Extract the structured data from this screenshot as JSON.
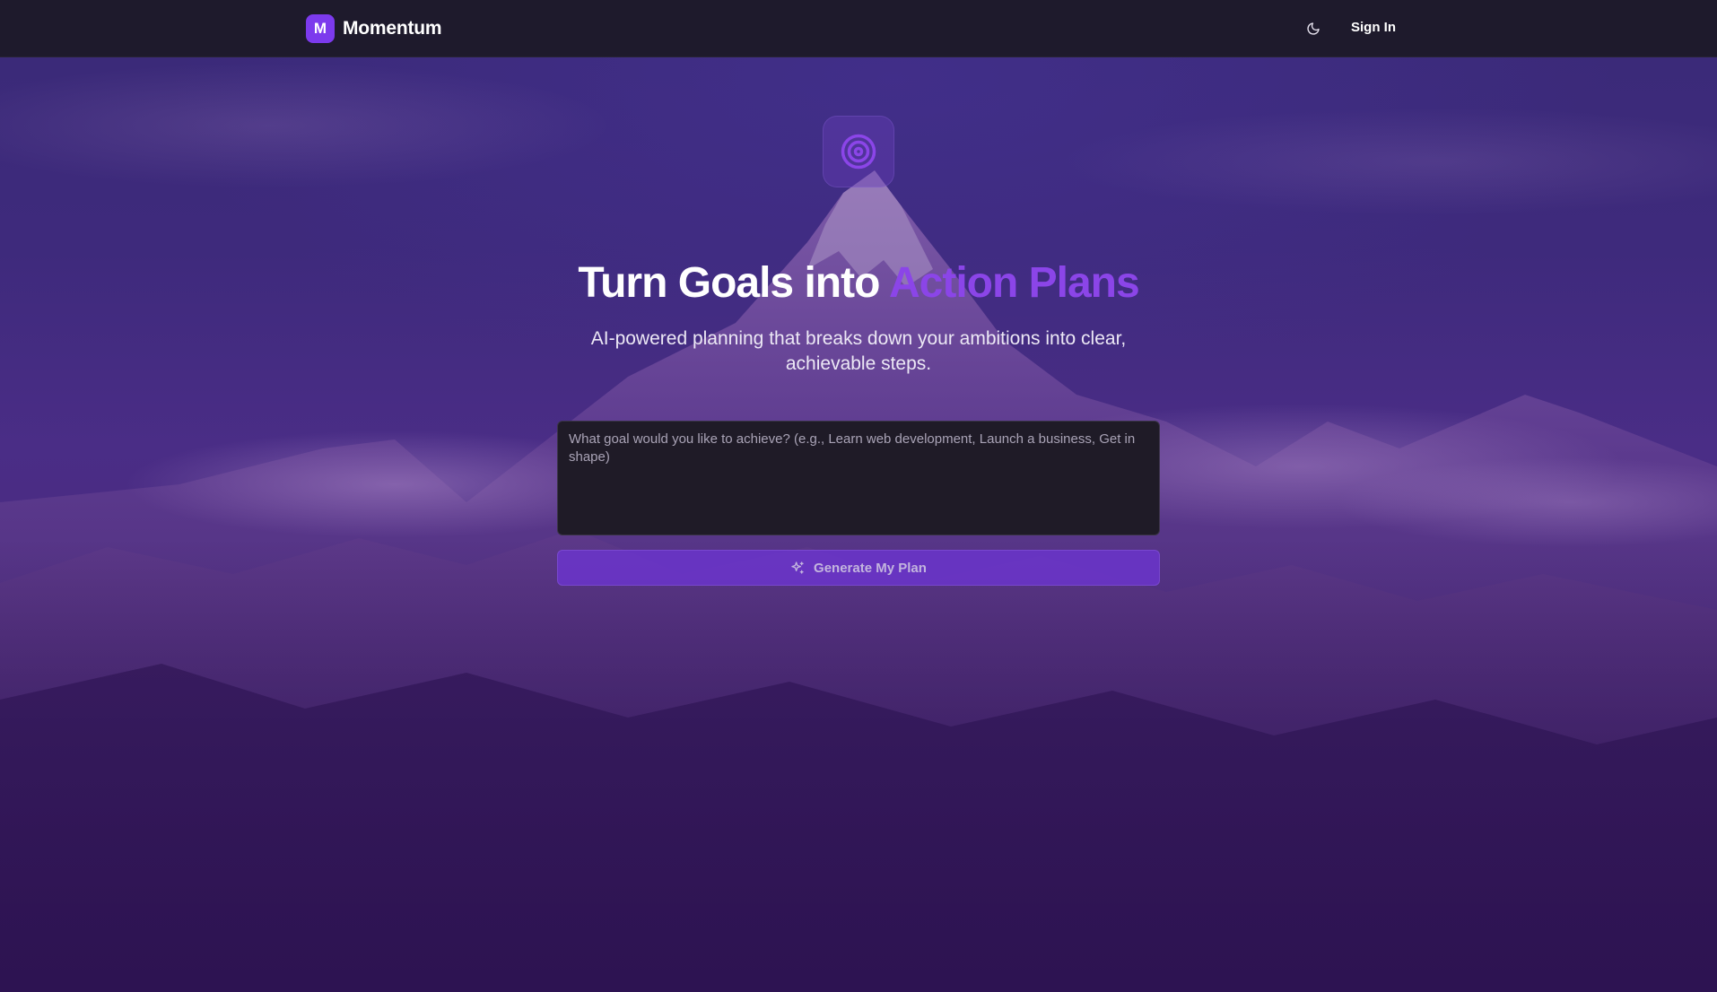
{
  "header": {
    "brand_initial": "M",
    "brand_name": "Momentum",
    "theme_icon": "moon-icon",
    "signin_label": "Sign In"
  },
  "hero": {
    "icon": "target-icon",
    "title_main": "Turn Goals into ",
    "title_accent": "Action Plans",
    "subtitle": "AI-powered planning that breaks down your ambitions into clear, achievable steps.",
    "goal_input_value": "",
    "goal_input_placeholder": "What goal would you like to achieve? (e.g., Learn web development, Launch a business, Get in shape)",
    "generate_icon": "sparkles-icon",
    "generate_label": "Generate My Plan"
  },
  "colors": {
    "accent": "#8b45e8",
    "brand_badge": "#7c3aed",
    "header_bg": "#1e1a2c",
    "button_bg": "#6a35c8",
    "input_bg": "#1f1b27"
  }
}
